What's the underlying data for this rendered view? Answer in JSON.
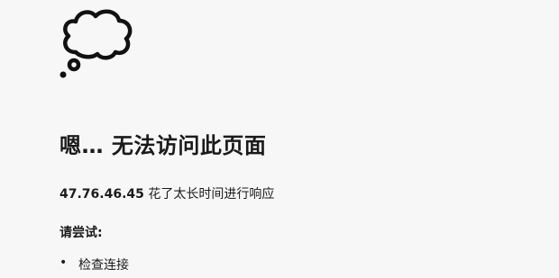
{
  "icon": "thought-cloud-icon",
  "error": {
    "title": "嗯… 无法访问此页面",
    "host": "47.76.46.45",
    "message": "花了太长时间进行响应"
  },
  "suggestions": {
    "heading": "请尝试:",
    "items": [
      {
        "label": "检查连接"
      }
    ]
  }
}
